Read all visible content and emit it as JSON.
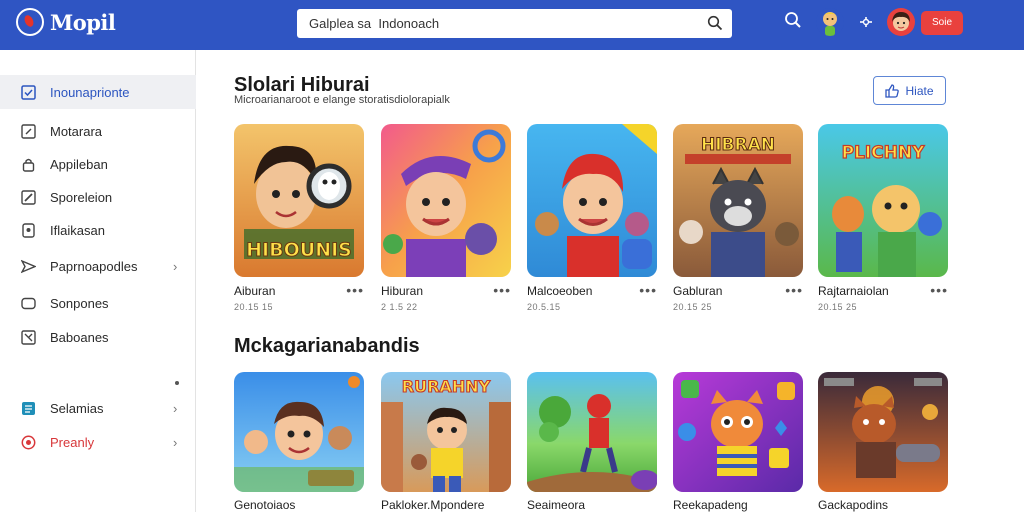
{
  "app": {
    "logo_text": "Mopil"
  },
  "search": {
    "value": "Galplea sa  Indonoach",
    "placeholder": ""
  },
  "topbar": {
    "pill_label": "Soie"
  },
  "sidebar": {
    "items": [
      {
        "label": "Inounaprionte",
        "icon": "checkbox-icon",
        "chevron": ""
      },
      {
        "label": "Motarara",
        "icon": "edit-box-icon",
        "chevron": ""
      },
      {
        "label": "Appileban",
        "icon": "lock-icon",
        "chevron": ""
      },
      {
        "label": "Sporeleion",
        "icon": "pencil-icon",
        "chevron": ""
      },
      {
        "label": "Iflaikasan",
        "icon": "device-icon",
        "chevron": ""
      },
      {
        "label": "Paprnoapodles",
        "icon": "send-icon",
        "chevron": "›"
      },
      {
        "label": "Sonpones",
        "icon": "card-icon",
        "chevron": ""
      },
      {
        "label": "Baboanes",
        "icon": "tool-icon",
        "chevron": ""
      },
      {
        "label": "Selamias",
        "icon": "document-icon",
        "chevron": "›"
      },
      {
        "label": "Preanly",
        "icon": "record-icon",
        "chevron": "›"
      }
    ]
  },
  "main": {
    "title": "Slolari Hiburai",
    "subtitle": "Microarianaroot e elange  storatisdiolorapialk",
    "filter_label": "Hiate"
  },
  "section2": {
    "title": "Mckagarianabandis"
  },
  "row1": [
    {
      "name": "Aiburan",
      "meta": "20.15 15",
      "art_text": "HIBOUNIS",
      "more": "•••"
    },
    {
      "name": "Hiburan",
      "meta": "2 1.5 22",
      "art_text": "",
      "more": "•••"
    },
    {
      "name": "Malcoeoben",
      "meta": "20.5.15",
      "art_text": "",
      "more": "•••"
    },
    {
      "name": "Gabluran",
      "meta": "20.15 25",
      "art_text": "HIBRAN",
      "more": "•••"
    },
    {
      "name": "Rajtarnaiolan",
      "meta": "20.15 25",
      "art_text": "PLICHNY",
      "more": "•••"
    }
  ],
  "row2": [
    {
      "name": "Genotoiaos",
      "art_text": ""
    },
    {
      "name": "Pakloker.Mpondere",
      "art_text": "RURAHNY"
    },
    {
      "name": "Seaimeora",
      "art_text": ""
    },
    {
      "name": "Reekapadeng",
      "art_text": ""
    },
    {
      "name": "Gackapodins",
      "art_text": ""
    }
  ],
  "colors": {
    "brand": "#2f55c3",
    "accent_red": "#e9413e",
    "active_text": "#2c55c0"
  }
}
